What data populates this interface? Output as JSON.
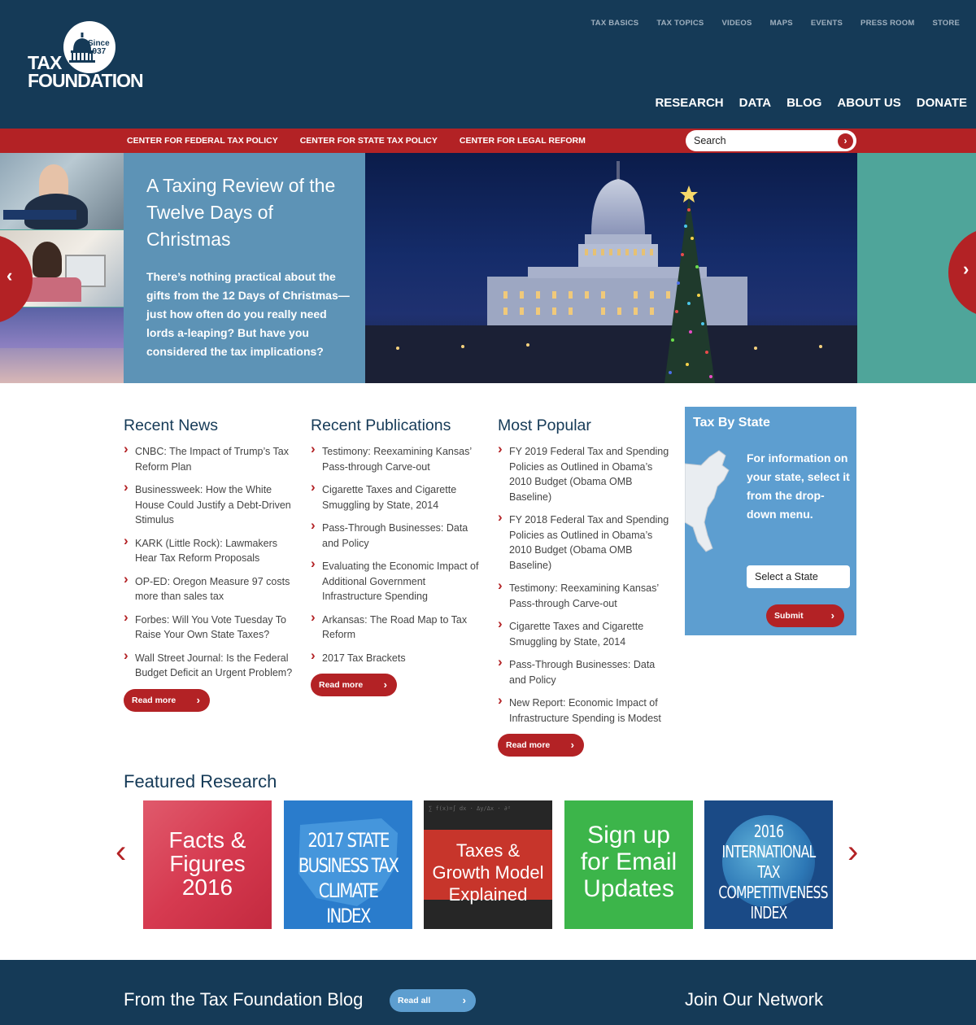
{
  "header": {
    "logo_line1": "TAX",
    "logo_line2": "FOUNDATION",
    "logo_since": "Since",
    "logo_year": "1937",
    "top_links": [
      "TAX BASICS",
      "TAX TOPICS",
      "VIDEOS",
      "MAPS",
      "EVENTS",
      "PRESS ROOM",
      "STORE"
    ],
    "main_nav": [
      "RESEARCH",
      "DATA",
      "BLOG",
      "ABOUT US",
      "DONATE"
    ]
  },
  "subnav": {
    "centers": [
      "CENTER FOR FEDERAL TAX POLICY",
      "CENTER FOR STATE TAX POLICY",
      "CENTER FOR LEGAL REFORM"
    ],
    "search_placeholder": "Search"
  },
  "hero": {
    "title": "A Taxing Review of the Twelve Days of Christmas",
    "description": "There’s nothing practical about the gifts from the 12 Days of Christmas—just how often do you really need lords a-leaping? But have you considered the tax implications?"
  },
  "recent_news": {
    "heading": "Recent News",
    "items": [
      "CNBC: The Impact of Trump’s Tax Reform Plan",
      "Businessweek: How the White House Could Justify a Debt-Driven Stimulus",
      "KARK (Little Rock): Lawmakers Hear Tax Reform Proposals",
      "OP-ED: Oregon Measure 97 costs more than sales tax",
      "Forbes: Will You Vote Tuesday To Raise Your Own State Taxes?",
      "Wall Street Journal: Is the Federal Budget Deficit an Urgent Problem?"
    ],
    "read_more": "Read more"
  },
  "recent_publications": {
    "heading": "Recent Publications",
    "items": [
      "Testimony: Reexamining Kansas’ Pass-through Carve-out",
      "Cigarette Taxes and Cigarette Smuggling by State, 2014",
      "Pass-Through Businesses: Data and Policy",
      "Evaluating the Economic Impact of Additional Government Infrastructure Spending",
      "Arkansas: The Road Map to Tax Reform",
      "2017 Tax Brackets"
    ],
    "read_more": "Read more"
  },
  "most_popular": {
    "heading": "Most Popular",
    "items": [
      "FY 2019 Federal Tax and Spending Policies as Outlined in Obama’s 2010 Budget (Obama OMB Baseline)",
      "FY 2018 Federal Tax and Spending Policies as Outlined in Obama’s 2010 Budget (Obama OMB Baseline)",
      "Testimony: Reexamining Kansas’ Pass-through Carve-out",
      "Cigarette Taxes and Cigarette Smuggling by State, 2014",
      "Pass-Through Businesses: Data and Policy",
      "New Report: Economic Impact of Infrastructure Spending is Modest"
    ],
    "read_more": "Read more"
  },
  "tax_by_state": {
    "heading": "Tax By State",
    "text": "For information on your state, select it from the drop-down menu.",
    "select_value": "Select a State",
    "submit": "Submit"
  },
  "featured": {
    "heading": "Featured Research",
    "tiles": [
      {
        "line1": "Facts &",
        "line2": "Figures",
        "line3": "2016"
      },
      {
        "line1": "2017 STATE",
        "line2": "BUSINESS TAX",
        "line3": "CLIMATE INDEX"
      },
      {
        "line1": "Taxes &",
        "line2": "Growth Model",
        "line3": "Explained"
      },
      {
        "line1": "Sign up",
        "line2": "for Email",
        "line3": "Updates"
      },
      {
        "line1": "2016",
        "line2": "INTERNATIONAL TAX",
        "line3": "COMPETITIVENESS",
        "line4": "INDEX"
      }
    ]
  },
  "footer": {
    "blog_heading": "From the Tax Foundation Blog",
    "read_all": "Read all",
    "join_heading": "Join Our Network"
  },
  "colors": {
    "navy": "#153a57",
    "red": "#b32225",
    "blue": "#5d9ed0",
    "teal": "#4fa59a"
  }
}
